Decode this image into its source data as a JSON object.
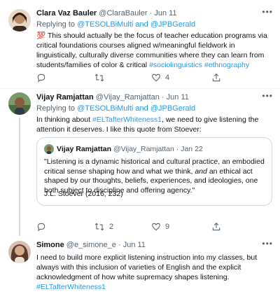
{
  "tweets": [
    {
      "name": "Clara Vaz Bauler",
      "handle": "@ClaraBauler",
      "sep": "·",
      "time": "Jun 11",
      "replying_prefix": "Replying to",
      "replying_to": "@TESOLBiMulti and @JPBGerald",
      "emoji": "💯",
      "text": "This should actually be the focus of teacher education programs via critical foundations courses aligned w/meaningful fieldwork in linguistically, culturally diverse communities where they can learn from students/families of color & critical",
      "hashtags": "#sociolinguistics #ethnography",
      "counts": {
        "reply": "",
        "retweet": "",
        "like": "4",
        "share": ""
      }
    },
    {
      "name": "Vijay Ramjattan",
      "handle": "@Vijay_Ramjattan",
      "sep": "·",
      "time": "Jun 11",
      "replying_prefix": "Replying to",
      "replying_to": "@TESOLBiMulti and @JPBGerald",
      "text_before": "In thinking about",
      "hashtag": "#ELTafterWhiteness1",
      "text_after": ", we need to give listening the attention it deserves. I like this quote from Stoever:",
      "quote": {
        "name": "Vijay Ramjattan",
        "handle": "@Vijay_Ramjattan",
        "sep": "·",
        "time": "Jan 22",
        "text_1": "\"Listening is a dynamic historical and cultural practice, an embodied critical sense shaping how and what we think,",
        "text_italic": "and",
        "text_2": "an ethical act shaped by our thoughts, beliefs, experiences, and ideologies, one both subject to discipline and offering agency.\"",
        "citation": "J.L. Stoever (2016, 232)"
      },
      "counts": {
        "reply": "",
        "retweet": "2",
        "like": "9",
        "share": ""
      }
    },
    {
      "name": "Simone",
      "handle": "@e_simone_e",
      "sep": "·",
      "time": "Jun 11",
      "text_before": "I need to build more explicit listening instruction into my classes, but always with this inclusion of varieties of English and the explicit acknowledgment of how white supremacy shapes listening.",
      "hashtag": "#ELTafterWhiteness1"
    }
  ],
  "icons": [
    "more-icon",
    "reply-icon",
    "retweet-icon",
    "like-icon",
    "share-icon"
  ],
  "colors": {
    "link": "#1d9bf0",
    "muted": "#536471",
    "text": "#0f1419",
    "border": "#cfd9de"
  }
}
